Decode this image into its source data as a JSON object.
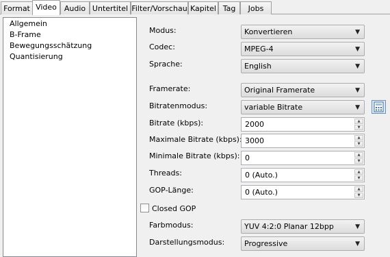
{
  "tabs": [
    "Format",
    "Video",
    "Audio",
    "Untertitel",
    "Filter/Vorschau",
    "Kapitel",
    "Tag",
    "Jobs"
  ],
  "active_tab": "Video",
  "sidebar": {
    "items": [
      "Allgemein",
      "B-Frame",
      "Bewegungsschätzung",
      "Quantisierung"
    ]
  },
  "form": {
    "modus": {
      "label": "Modus:",
      "value": "Konvertieren"
    },
    "codec": {
      "label": "Codec:",
      "value": "MPEG-4"
    },
    "sprache": {
      "label": "Sprache:",
      "value": "English"
    },
    "framerate": {
      "label": "Framerate:",
      "value": "Original Framerate"
    },
    "bitratenmodus": {
      "label": "Bitratenmodus:",
      "value": "variable Bitrate"
    },
    "bitrate": {
      "label": "Bitrate (kbps):",
      "value": "2000"
    },
    "max_bitrate": {
      "label": "Maximale Bitrate (kbps):",
      "value": "3000"
    },
    "min_bitrate": {
      "label": "Minimale Bitrate (kbps):",
      "value": "0"
    },
    "threads": {
      "label": "Threads:",
      "value": "0 (Auto.)"
    },
    "gop": {
      "label": "GOP-Länge:",
      "value": "0 (Auto.)"
    },
    "closed_gop": {
      "label": "Closed GOP",
      "checked": false
    },
    "farbmodus": {
      "label": "Farbmodus:",
      "value": "YUV 4:2:0 Planar 12bpp"
    },
    "darstellungsmodus": {
      "label": "Darstellungsmodus:",
      "value": "Progressive"
    }
  },
  "icons": {
    "bitrate_calculator": "calculator-icon"
  },
  "colors": {
    "window_bg": "#f0f0f0",
    "panel_bg": "#ffffff",
    "border": "#a0a0a0"
  }
}
